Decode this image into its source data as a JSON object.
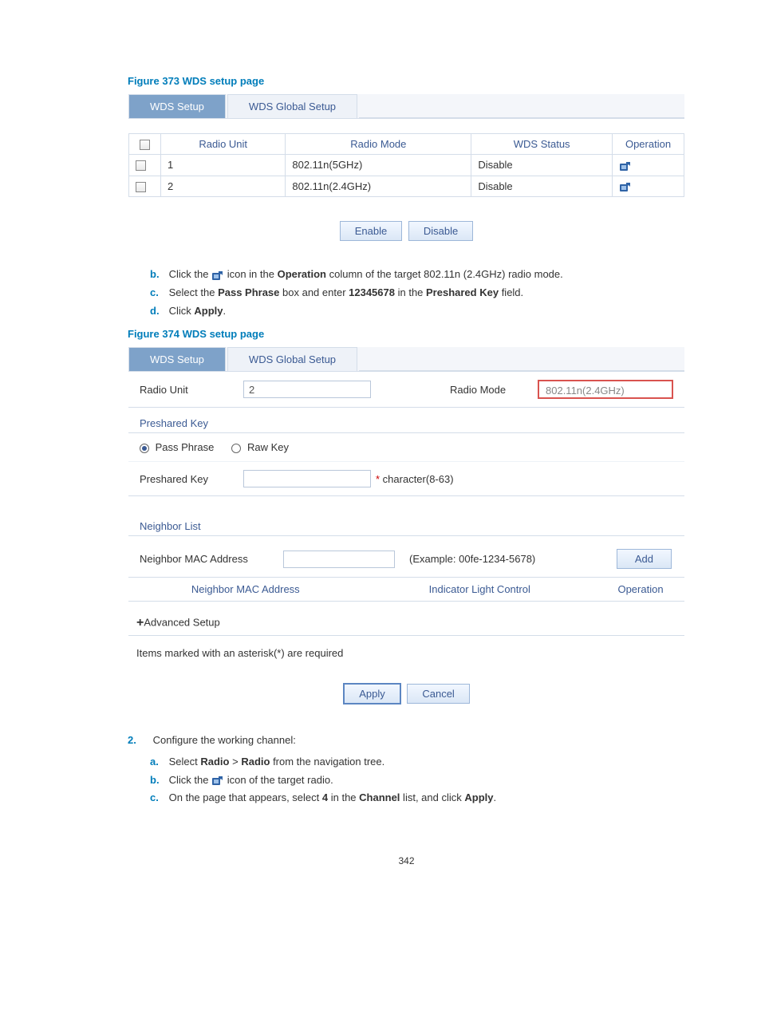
{
  "fig373_caption": "Figure 373 WDS setup page",
  "fig374_caption": "Figure 374 WDS setup page",
  "tabs": {
    "wds_setup": "WDS Setup",
    "wds_global": "WDS Global Setup"
  },
  "table373": {
    "headers": {
      "radio_unit": "Radio Unit",
      "radio_mode": "Radio Mode",
      "wds_status": "WDS Status",
      "operation": "Operation"
    },
    "rows": [
      {
        "unit": "1",
        "mode": "802.11n(5GHz)",
        "status": "Disable"
      },
      {
        "unit": "2",
        "mode": "802.11n(2.4GHz)",
        "status": "Disable"
      }
    ]
  },
  "buttons": {
    "enable": "Enable",
    "disable": "Disable",
    "add": "Add",
    "apply": "Apply",
    "cancel": "Cancel"
  },
  "step_b": {
    "lead": "Click the ",
    "mid": " icon in the ",
    "op": "Operation",
    "tail": " column of the target 802.11n (2.4GHz) radio mode."
  },
  "step_c": {
    "lead": "Select the ",
    "pp": "Pass Phrase",
    "mid": " box and enter ",
    "val": "12345678",
    "mid2": " in the ",
    "pk": "Preshared Key",
    "tail": " field."
  },
  "step_d": {
    "lead": "Click ",
    "apply": "Apply",
    "tail": "."
  },
  "form374": {
    "radio_unit_lbl": "Radio Unit",
    "radio_unit_val": "2",
    "radio_mode_lbl": "Radio Mode",
    "radio_mode_val": "802.11n(2.4GHz)",
    "pk_section": "Preshared Key",
    "pass_phrase": "Pass Phrase",
    "raw_key": "Raw Key",
    "pk_lbl": "Preshared Key",
    "pk_hint_star": "*",
    "pk_hint": " character(8-63)",
    "nl_section": "Neighbor List",
    "nmac_lbl": "Neighbor MAC Address",
    "nmac_example": "(Example: 00fe-1234-5678)",
    "sub_nmac": "Neighbor MAC Address",
    "sub_ilc": "Indicator Light Control",
    "sub_op": "Operation",
    "adv": "Advanced Setup",
    "req_note": "Items marked with an asterisk(*) are required"
  },
  "step2": {
    "num": "2.",
    "text": "Configure the working channel:",
    "a_lead": "Select ",
    "a_b1": "Radio",
    "a_mid": " > ",
    "a_b2": "Radio",
    "a_tail": " from the navigation tree.",
    "b_lead": "Click the ",
    "b_tail": " icon of the target radio.",
    "c_lead": "On the page that appears, select ",
    "c_b1": "4",
    "c_mid": " in the ",
    "c_b2": "Channel",
    "c_mid2": " list, and click ",
    "c_b3": "Apply",
    "c_tail": "."
  },
  "labels": {
    "b": "b.",
    "c": "c.",
    "d": "d.",
    "a": "a."
  },
  "page_number": "342"
}
